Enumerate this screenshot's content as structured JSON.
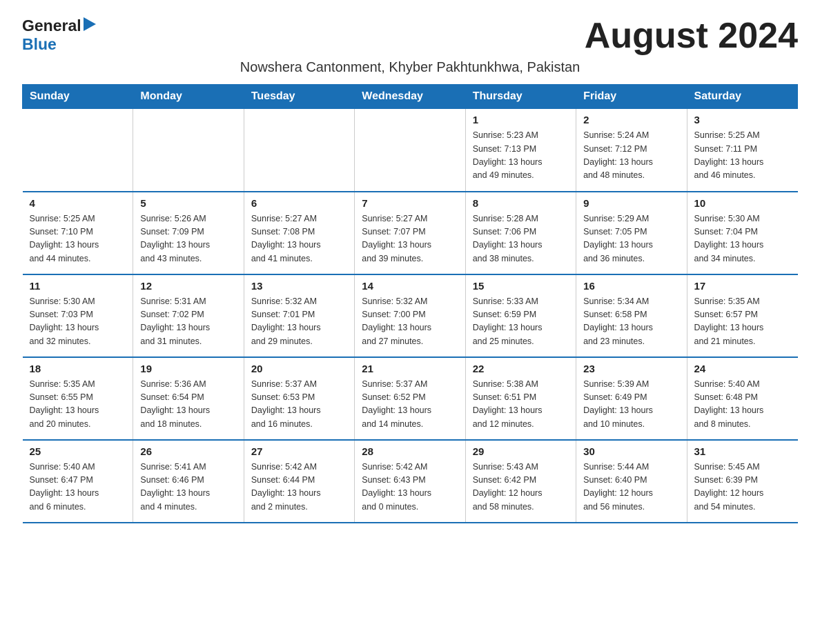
{
  "header": {
    "logo_general": "General",
    "logo_blue": "Blue",
    "month_title": "August 2024",
    "subtitle": "Nowshera Cantonment, Khyber Pakhtunkhwa, Pakistan"
  },
  "days_of_week": [
    "Sunday",
    "Monday",
    "Tuesday",
    "Wednesday",
    "Thursday",
    "Friday",
    "Saturday"
  ],
  "weeks": [
    {
      "days": [
        {
          "number": "",
          "info": ""
        },
        {
          "number": "",
          "info": ""
        },
        {
          "number": "",
          "info": ""
        },
        {
          "number": "",
          "info": ""
        },
        {
          "number": "1",
          "info": "Sunrise: 5:23 AM\nSunset: 7:13 PM\nDaylight: 13 hours\nand 49 minutes."
        },
        {
          "number": "2",
          "info": "Sunrise: 5:24 AM\nSunset: 7:12 PM\nDaylight: 13 hours\nand 48 minutes."
        },
        {
          "number": "3",
          "info": "Sunrise: 5:25 AM\nSunset: 7:11 PM\nDaylight: 13 hours\nand 46 minutes."
        }
      ]
    },
    {
      "days": [
        {
          "number": "4",
          "info": "Sunrise: 5:25 AM\nSunset: 7:10 PM\nDaylight: 13 hours\nand 44 minutes."
        },
        {
          "number": "5",
          "info": "Sunrise: 5:26 AM\nSunset: 7:09 PM\nDaylight: 13 hours\nand 43 minutes."
        },
        {
          "number": "6",
          "info": "Sunrise: 5:27 AM\nSunset: 7:08 PM\nDaylight: 13 hours\nand 41 minutes."
        },
        {
          "number": "7",
          "info": "Sunrise: 5:27 AM\nSunset: 7:07 PM\nDaylight: 13 hours\nand 39 minutes."
        },
        {
          "number": "8",
          "info": "Sunrise: 5:28 AM\nSunset: 7:06 PM\nDaylight: 13 hours\nand 38 minutes."
        },
        {
          "number": "9",
          "info": "Sunrise: 5:29 AM\nSunset: 7:05 PM\nDaylight: 13 hours\nand 36 minutes."
        },
        {
          "number": "10",
          "info": "Sunrise: 5:30 AM\nSunset: 7:04 PM\nDaylight: 13 hours\nand 34 minutes."
        }
      ]
    },
    {
      "days": [
        {
          "number": "11",
          "info": "Sunrise: 5:30 AM\nSunset: 7:03 PM\nDaylight: 13 hours\nand 32 minutes."
        },
        {
          "number": "12",
          "info": "Sunrise: 5:31 AM\nSunset: 7:02 PM\nDaylight: 13 hours\nand 31 minutes."
        },
        {
          "number": "13",
          "info": "Sunrise: 5:32 AM\nSunset: 7:01 PM\nDaylight: 13 hours\nand 29 minutes."
        },
        {
          "number": "14",
          "info": "Sunrise: 5:32 AM\nSunset: 7:00 PM\nDaylight: 13 hours\nand 27 minutes."
        },
        {
          "number": "15",
          "info": "Sunrise: 5:33 AM\nSunset: 6:59 PM\nDaylight: 13 hours\nand 25 minutes."
        },
        {
          "number": "16",
          "info": "Sunrise: 5:34 AM\nSunset: 6:58 PM\nDaylight: 13 hours\nand 23 minutes."
        },
        {
          "number": "17",
          "info": "Sunrise: 5:35 AM\nSunset: 6:57 PM\nDaylight: 13 hours\nand 21 minutes."
        }
      ]
    },
    {
      "days": [
        {
          "number": "18",
          "info": "Sunrise: 5:35 AM\nSunset: 6:55 PM\nDaylight: 13 hours\nand 20 minutes."
        },
        {
          "number": "19",
          "info": "Sunrise: 5:36 AM\nSunset: 6:54 PM\nDaylight: 13 hours\nand 18 minutes."
        },
        {
          "number": "20",
          "info": "Sunrise: 5:37 AM\nSunset: 6:53 PM\nDaylight: 13 hours\nand 16 minutes."
        },
        {
          "number": "21",
          "info": "Sunrise: 5:37 AM\nSunset: 6:52 PM\nDaylight: 13 hours\nand 14 minutes."
        },
        {
          "number": "22",
          "info": "Sunrise: 5:38 AM\nSunset: 6:51 PM\nDaylight: 13 hours\nand 12 minutes."
        },
        {
          "number": "23",
          "info": "Sunrise: 5:39 AM\nSunset: 6:49 PM\nDaylight: 13 hours\nand 10 minutes."
        },
        {
          "number": "24",
          "info": "Sunrise: 5:40 AM\nSunset: 6:48 PM\nDaylight: 13 hours\nand 8 minutes."
        }
      ]
    },
    {
      "days": [
        {
          "number": "25",
          "info": "Sunrise: 5:40 AM\nSunset: 6:47 PM\nDaylight: 13 hours\nand 6 minutes."
        },
        {
          "number": "26",
          "info": "Sunrise: 5:41 AM\nSunset: 6:46 PM\nDaylight: 13 hours\nand 4 minutes."
        },
        {
          "number": "27",
          "info": "Sunrise: 5:42 AM\nSunset: 6:44 PM\nDaylight: 13 hours\nand 2 minutes."
        },
        {
          "number": "28",
          "info": "Sunrise: 5:42 AM\nSunset: 6:43 PM\nDaylight: 13 hours\nand 0 minutes."
        },
        {
          "number": "29",
          "info": "Sunrise: 5:43 AM\nSunset: 6:42 PM\nDaylight: 12 hours\nand 58 minutes."
        },
        {
          "number": "30",
          "info": "Sunrise: 5:44 AM\nSunset: 6:40 PM\nDaylight: 12 hours\nand 56 minutes."
        },
        {
          "number": "31",
          "info": "Sunrise: 5:45 AM\nSunset: 6:39 PM\nDaylight: 12 hours\nand 54 minutes."
        }
      ]
    }
  ]
}
